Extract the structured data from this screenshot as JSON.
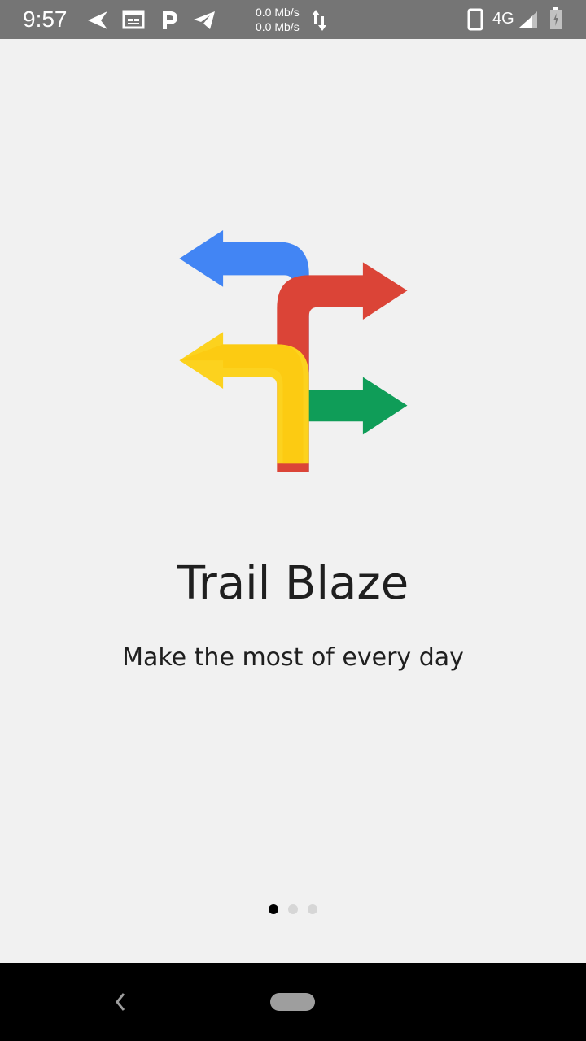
{
  "status_bar": {
    "time": "9:57",
    "net_up": "0.0 Mb/s",
    "net_down": "0.0 Mb/s",
    "network": "4G",
    "icons": [
      "navigation-icon",
      "calendar-icon",
      "parking-icon",
      "telegram-icon",
      "data-arrows-icon",
      "phone-icon",
      "signal-icon",
      "battery-icon"
    ],
    "color": "#757575"
  },
  "onboarding": {
    "logo_icon": "trail-blaze-arrows-logo",
    "title": "Trail Blaze",
    "subtitle": "Make the most of every day",
    "page_indicator": {
      "count": 3,
      "active": 1
    }
  },
  "nav_bar": {
    "icons": [
      "back-icon",
      "home-pill-icon"
    ]
  },
  "colors": {
    "blue": "#4285f4",
    "red": "#db4437",
    "yellow": "#fcd21e",
    "green": "#0f9d58",
    "background": "#f1f1f1"
  }
}
